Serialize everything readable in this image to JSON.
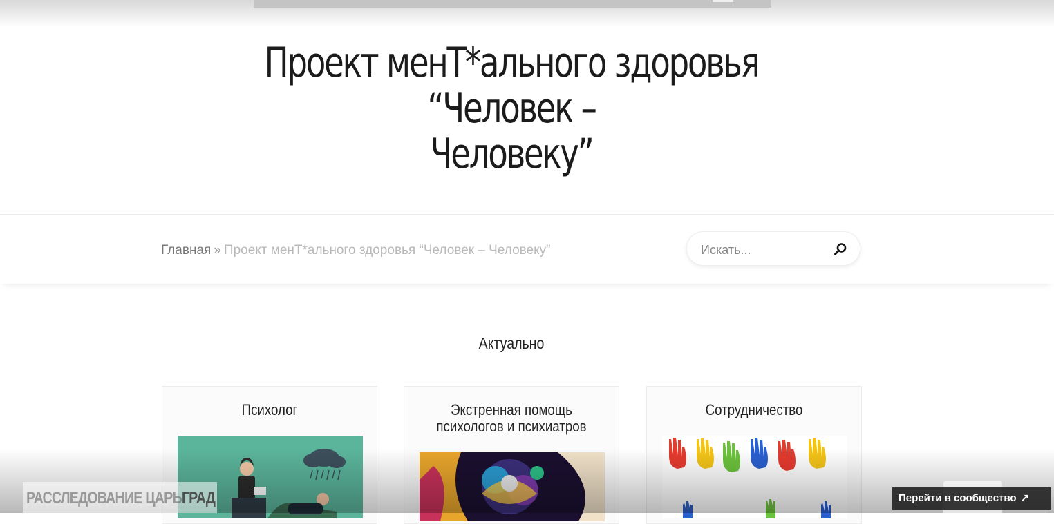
{
  "hero": {
    "title_line1": "Проект менТ*ального здоровья “Человек –",
    "title_line2": "Человеку”"
  },
  "breadcrumb": {
    "home": "Главная",
    "separator": "»",
    "current": "Проект менТ*ального здоровья “Человек – Человеку”"
  },
  "search": {
    "placeholder": "Искать...",
    "icon": "search-icon"
  },
  "section": {
    "heading": "Актуально"
  },
  "cards": [
    {
      "title": "Психолог",
      "image": "psychologist-illustration"
    },
    {
      "title_line1": "Экстренная помощь",
      "title_line2": "психологов и психиатров",
      "image": "abstract-colorful-head"
    },
    {
      "title": "Сотрудничество",
      "image": "painted-hands"
    }
  ],
  "overlay": {
    "watermark_part1": "РАССЛЕДОВАНИЕ ЦАРЬ",
    "watermark_part2": "ГРАД",
    "community_button": "Перейти в сообщество",
    "community_icon": "external-arrow-icon"
  },
  "colors": {
    "text_dark": "#1b1b1b",
    "breadcrumb_muted": "#b9b9b9",
    "card_bg": "#fbfbfb",
    "psych_bg": "#5bb59b"
  }
}
